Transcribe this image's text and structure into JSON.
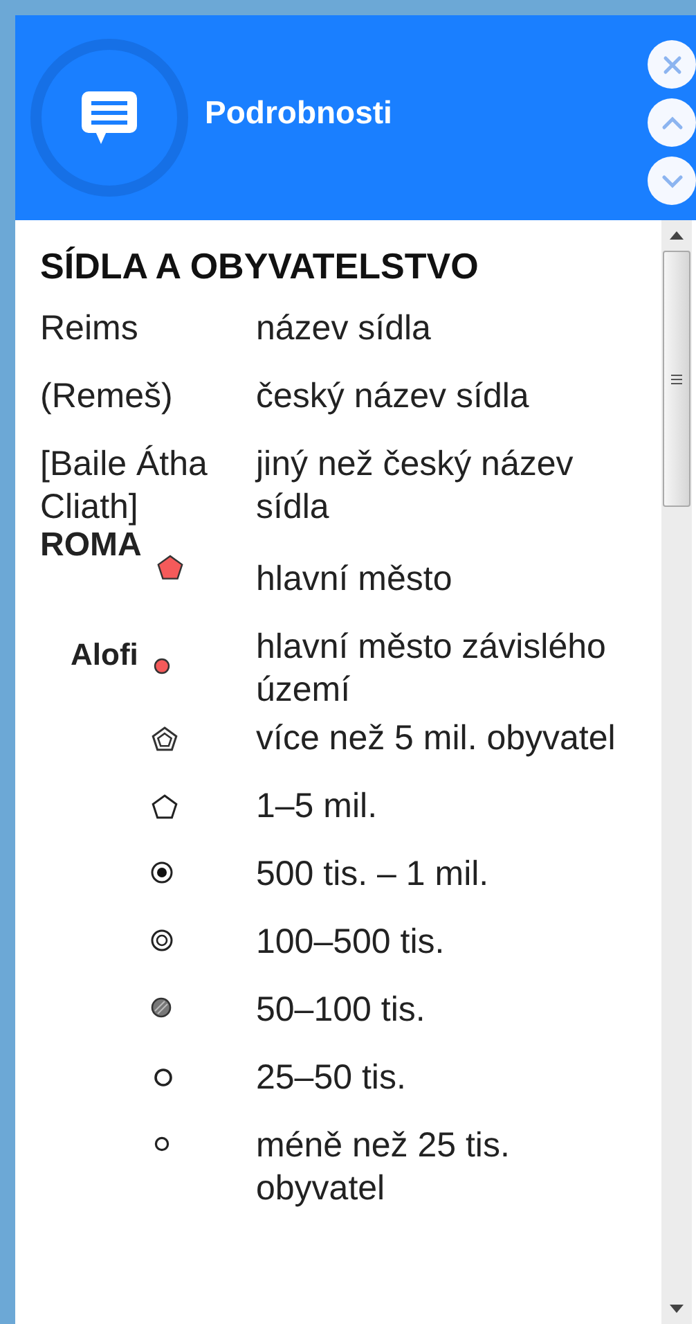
{
  "header": {
    "title": "Podrobnosti"
  },
  "section": {
    "title": "SÍDLA A OBYVATELSTVO",
    "items": [
      {
        "kind": "text",
        "label": "Reims",
        "description": "název sídla"
      },
      {
        "kind": "text",
        "label": "(Remeš)",
        "description": "český název sídla"
      },
      {
        "kind": "text",
        "label": "[Baile Átha Cliath]",
        "description": "jiný než český název sídla"
      },
      {
        "kind": "capital",
        "label": "ROMA",
        "description": "hlavní město"
      },
      {
        "kind": "dependency",
        "label": "Alofi",
        "description": "hlavní město závislého území"
      },
      {
        "kind": "pentagon2",
        "description": "více než 5 mil. obyvatel"
      },
      {
        "kind": "pentagon",
        "description": "1–5 mil."
      },
      {
        "kind": "dotcircle",
        "description": "500 tis. – 1 mil."
      },
      {
        "kind": "ringcircle",
        "description": "100–500 tis."
      },
      {
        "kind": "hatched",
        "description": "50–100 tis."
      },
      {
        "kind": "circle",
        "description": "25–50 tis."
      },
      {
        "kind": "smallcircle",
        "description": "méně než 25 tis. obyvatel"
      }
    ]
  }
}
